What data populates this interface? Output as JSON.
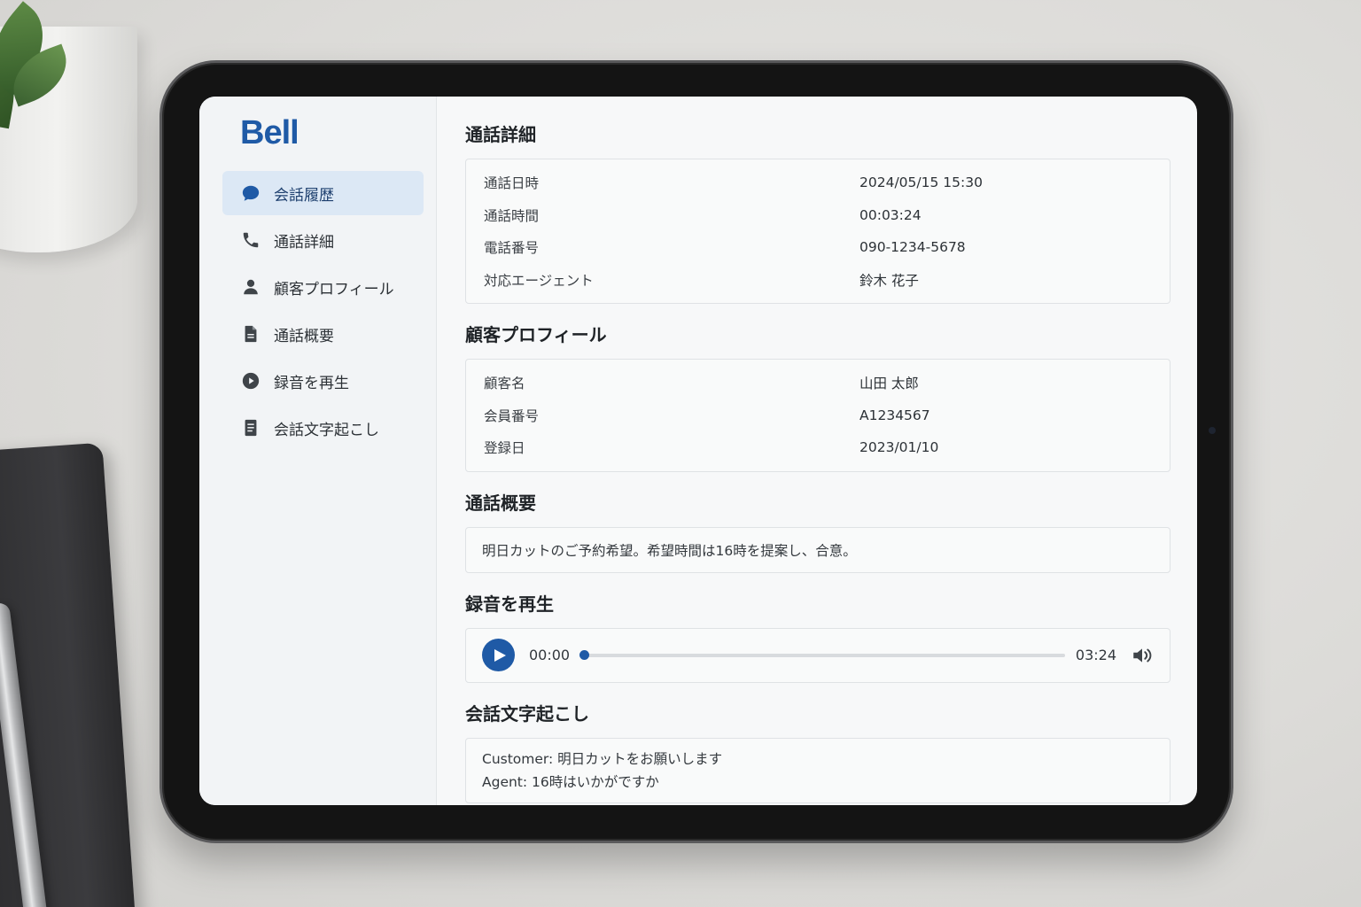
{
  "brand": {
    "logo": "Bell",
    "accent": "#1f5aa6"
  },
  "sidebar": {
    "items": [
      {
        "label": "会話履歴",
        "icon": "chat-bubble-icon",
        "active": true
      },
      {
        "label": "通話詳細",
        "icon": "phone-icon",
        "active": false
      },
      {
        "label": "顧客プロフィール",
        "icon": "person-icon",
        "active": false
      },
      {
        "label": "通話概要",
        "icon": "document-icon",
        "active": false
      },
      {
        "label": "録音を再生",
        "icon": "play-circle-icon",
        "active": false
      },
      {
        "label": "会話文字起こし",
        "icon": "text-document-icon",
        "active": false
      }
    ]
  },
  "call_details": {
    "title": "通話詳細",
    "rows": [
      {
        "label": "通話日時",
        "value": "2024/05/15 15:30"
      },
      {
        "label": "通話時間",
        "value": "00:03:24"
      },
      {
        "label": "電話番号",
        "value": "090-1234-5678"
      },
      {
        "label": "対応エージェント",
        "value": "鈴木 花子"
      }
    ]
  },
  "customer_profile": {
    "title": "顧客プロフィール",
    "rows": [
      {
        "label": "顧客名",
        "value": "山田 太郎"
      },
      {
        "label": "会員番号",
        "value": "A1234567"
      },
      {
        "label": "登録日",
        "value": "2023/01/10"
      }
    ]
  },
  "summary": {
    "title": "通話概要",
    "text": "明日カットのご予約希望。希望時間は16時を提案し、合意。"
  },
  "recording": {
    "title": "録音を再生",
    "current_time": "00:00",
    "duration": "03:24",
    "progress": 0
  },
  "transcript": {
    "title": "会話文字起こし",
    "lines": [
      "Customer: 明日カットをお願いします",
      "Agent: 16時はいかがですか"
    ]
  }
}
